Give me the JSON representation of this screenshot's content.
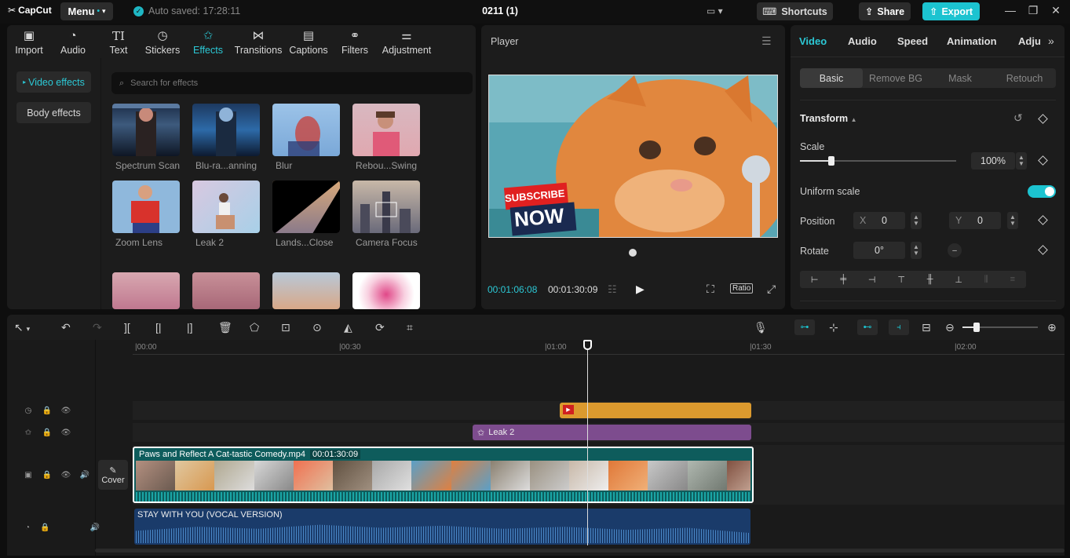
{
  "app": {
    "logo": "CapCut",
    "menu": "Menu",
    "autosave": "Auto saved: 17:28:11",
    "project": "0211 (1)",
    "shortcuts": "Shortcuts",
    "share": "Share",
    "export": "Export"
  },
  "left": {
    "tabs": [
      {
        "label": "Import",
        "icon": "import-icon"
      },
      {
        "label": "Audio",
        "icon": "audio-icon"
      },
      {
        "label": "Text",
        "icon": "text-icon"
      },
      {
        "label": "Stickers",
        "icon": "stickers-icon"
      },
      {
        "label": "Effects",
        "icon": "effects-icon"
      },
      {
        "label": "Transitions",
        "icon": "transitions-icon"
      },
      {
        "label": "Captions",
        "icon": "captions-icon"
      },
      {
        "label": "Filters",
        "icon": "filters-icon"
      },
      {
        "label": "Adjustment",
        "icon": "adjustment-icon"
      }
    ],
    "categories": [
      "Video effects",
      "Body effects"
    ],
    "search_placeholder": "Search for effects",
    "effects": [
      "Spectrum Scan",
      "Blu-ra...anning",
      "Blur",
      "Rebou...Swing",
      "Zoom Lens",
      "Leak 2",
      "Lands...Close",
      "Camera Focus"
    ]
  },
  "player": {
    "title": "Player",
    "current": "00:01:06:08",
    "total": "00:01:30:09",
    "ratio": "Ratio",
    "overlay_top": "SUBSCRIBE",
    "overlay_bottom": "NOW"
  },
  "right": {
    "tabs": [
      "Video",
      "Audio",
      "Speed",
      "Animation",
      "Adju"
    ],
    "subtabs": [
      "Basic",
      "Remove BG",
      "Mask",
      "Retouch"
    ],
    "transform": "Transform",
    "scale_label": "Scale",
    "scale_value": "100%",
    "scale_level": 0.2,
    "uniform_scale": "Uniform scale",
    "uniform_scale_on": true,
    "position_label": "Position",
    "x_label": "X",
    "x_value": "0",
    "y_label": "Y",
    "y_value": "0",
    "rotate_label": "Rotate",
    "rotate_value": "0°"
  },
  "timeline": {
    "ticks": [
      "|00:00",
      "|00:30",
      "|01:00",
      "|01:30",
      "|02:00"
    ],
    "effect_clip": "Leak 2",
    "video_clip_name": "Paws and Reflect A Cat-tastic Comedy.mp4",
    "video_clip_duration": "00:01:30:09",
    "cover": "Cover",
    "audio_clip": "STAY WITH YOU (VOCAL VERSION)"
  },
  "colors": {
    "accent": "#1cc3d0",
    "sticker_clip": "#dc9a2e",
    "effect_clip": "#7d4c8e",
    "video_clip": "#0e5c5c",
    "audio_clip": "#1a3b6a"
  }
}
